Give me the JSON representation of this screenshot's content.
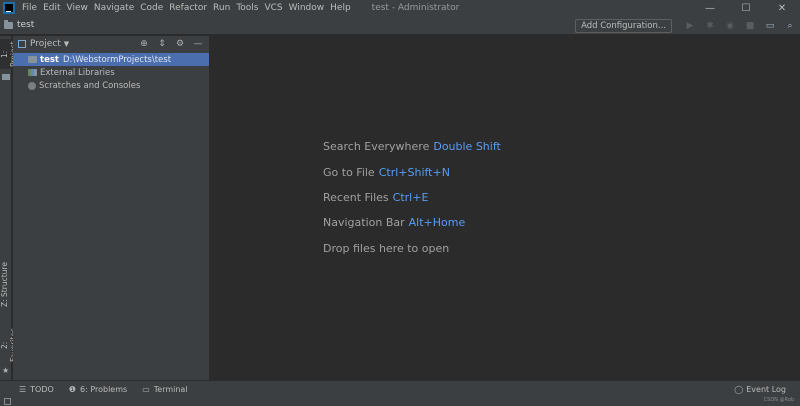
{
  "menu": [
    "File",
    "Edit",
    "View",
    "Navigate",
    "Code",
    "Refactor",
    "Run",
    "Tools",
    "VCS",
    "Window",
    "Help"
  ],
  "window_title": "test - Administrator",
  "window_controls": [
    "—",
    "☐",
    "✕"
  ],
  "navbar": {
    "crumb": "test",
    "add_config": "Add Configuration..."
  },
  "left_stripe": {
    "project": "1: Project",
    "structure": "Z: Structure",
    "favorites": "2: Favorites"
  },
  "project_panel": {
    "title": "Project",
    "tree": {
      "root_name": "test",
      "root_path": "D:\\WebstormProjects\\test",
      "external_libraries": "External Libraries",
      "scratches": "Scratches and Consoles"
    }
  },
  "editor_hints": [
    {
      "label": "Search Everywhere",
      "key": "Double Shift"
    },
    {
      "label": "Go to File",
      "key": "Ctrl+Shift+N"
    },
    {
      "label": "Recent Files",
      "key": "Ctrl+E"
    },
    {
      "label": "Navigation Bar",
      "key": "Alt+Home"
    },
    {
      "label": "Drop files here to open",
      "key": ""
    }
  ],
  "bottom_bar": {
    "todo": "TODO",
    "problems": "6: Problems",
    "terminal": "Terminal",
    "event_log": "Event Log"
  },
  "watermark": "CSDN @Rob"
}
